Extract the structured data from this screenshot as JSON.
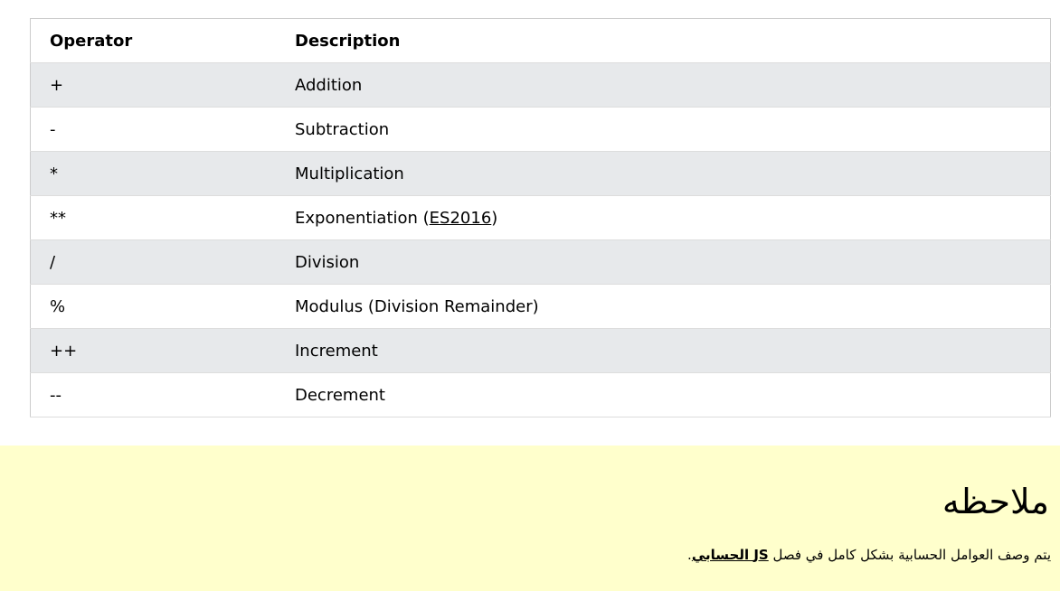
{
  "table": {
    "headers": {
      "operator": "Operator",
      "description": "Description"
    },
    "rows": [
      {
        "operator": "+",
        "description": "Addition"
      },
      {
        "operator": "-",
        "description": "Subtraction"
      },
      {
        "operator": "*",
        "description": "Multiplication"
      },
      {
        "operator": "**",
        "description": "Exponentiation (",
        "link": "ES2016",
        "suffix": ")"
      },
      {
        "operator": "/",
        "description": "Division"
      },
      {
        "operator": "%",
        "description": "Modulus (Division Remainder)"
      },
      {
        "operator": "++",
        "description": "Increment"
      },
      {
        "operator": "--",
        "description": "Decrement"
      }
    ]
  },
  "note": {
    "title": "ملاحظه",
    "text_before": "يتم وصف العوامل الحسابية بشكل كامل في فصل ",
    "link": "JS الحسابي",
    "text_after": "."
  },
  "colors": {
    "row_alt": "#e7e9eb",
    "note_bg": "#ffffcc"
  }
}
